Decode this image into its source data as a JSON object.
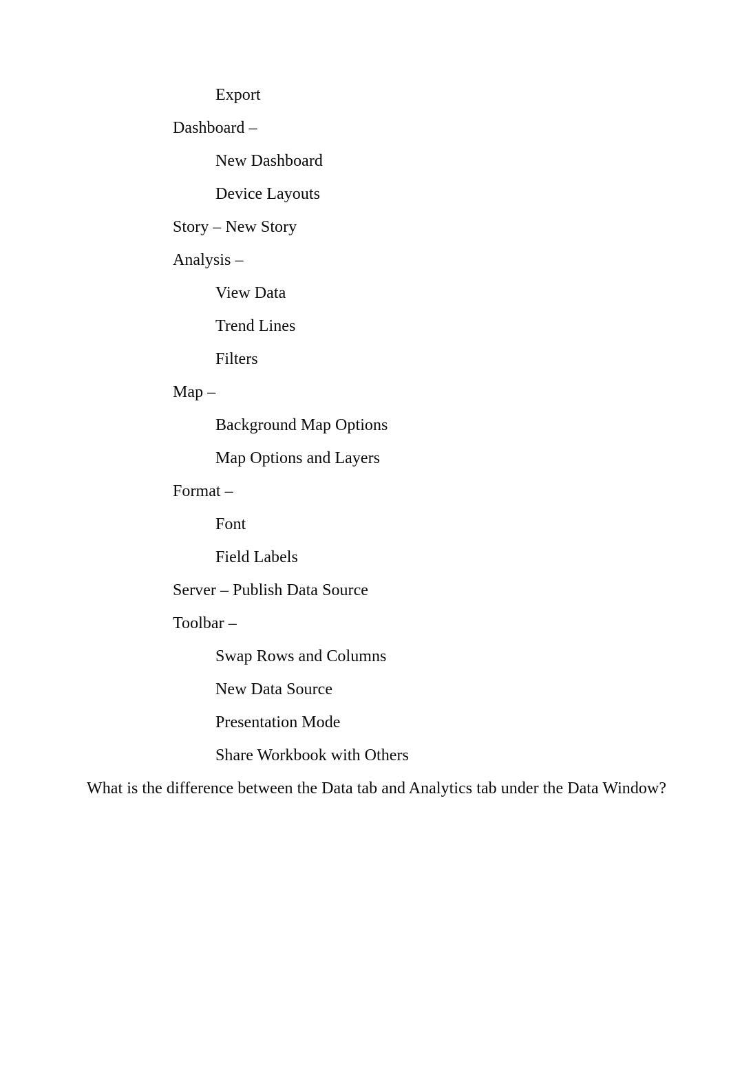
{
  "document": {
    "page_background": "#ffffff",
    "text_color": "#0a0a0a",
    "lines": [
      {
        "text": "Export",
        "level": 2
      },
      {
        "text": "Dashboard –",
        "level": 1
      },
      {
        "text": "New Dashboard",
        "level": 2
      },
      {
        "text": "Device Layouts",
        "level": 2
      },
      {
        "text": "Story – New Story",
        "level": 1
      },
      {
        "text": "Analysis –",
        "level": 1
      },
      {
        "text": "View Data",
        "level": 2
      },
      {
        "text": "Trend Lines",
        "level": 2
      },
      {
        "text": "Filters",
        "level": 2
      },
      {
        "text": "Map –",
        "level": 1
      },
      {
        "text": "Background Map Options",
        "level": 2
      },
      {
        "text": "Map Options and Layers",
        "level": 2
      },
      {
        "text": "Format –",
        "level": 1
      },
      {
        "text": "Font",
        "level": 2
      },
      {
        "text": "Field Labels",
        "level": 2
      },
      {
        "text": "Server – Publish Data Source",
        "level": 1
      },
      {
        "text": "Toolbar –",
        "level": 1
      },
      {
        "text": "Swap Rows and Columns",
        "level": 2
      },
      {
        "text": "New Data Source",
        "level": 2
      },
      {
        "text": "Presentation Mode",
        "level": 2
      },
      {
        "text": "Share Workbook with Others",
        "level": 2
      },
      {
        "text": "What is the difference between the Data tab and Analytics tab under the Data Window?",
        "level": 0
      }
    ]
  }
}
